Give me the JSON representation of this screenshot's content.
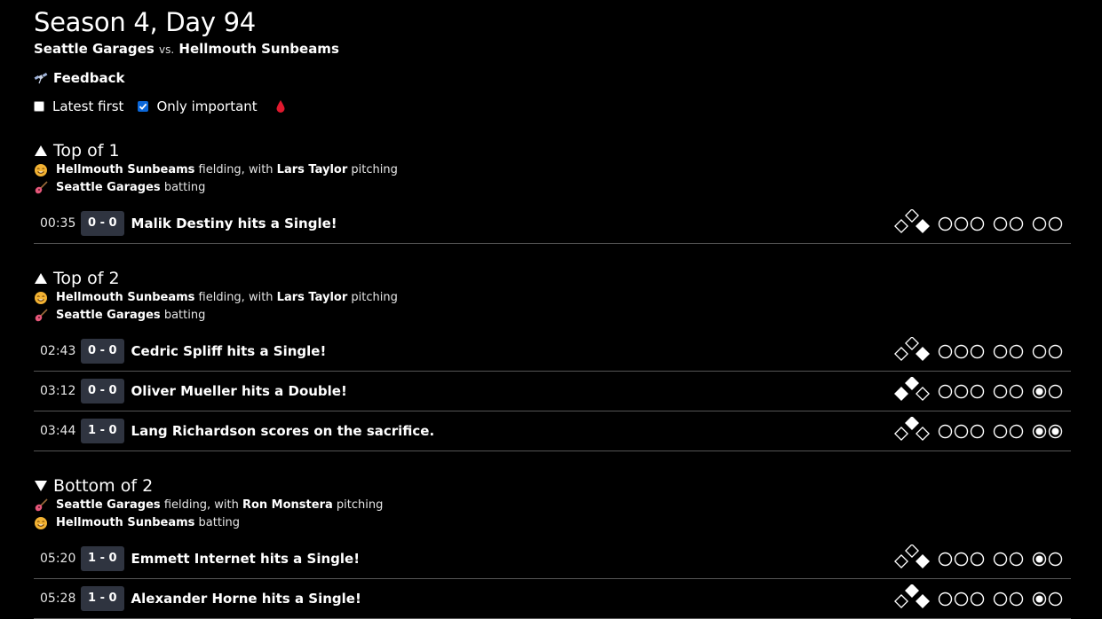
{
  "page": {
    "title": "Season 4, Day 94",
    "away_team": "Seattle Garages",
    "vs": "vs.",
    "home_team": "Hellmouth Sunbeams",
    "feedback_label": "Feedback",
    "options": [
      {
        "label": "Latest first",
        "checked": false
      },
      {
        "label": "Only important",
        "checked": true
      }
    ]
  },
  "halves": [
    {
      "heading": "Top of 1",
      "direction": "up",
      "fielding_team": "Hellmouth Sunbeams",
      "fielding_text": "fielding, with",
      "pitcher": "Lars Taylor",
      "pitching_text": "pitching",
      "batting_team": "Seattle Garages",
      "batting_text": "batting",
      "fielding_icon": "sun-face-icon",
      "batting_icon": "guitar-icon",
      "events": [
        {
          "time": "00:35",
          "score": "0 - 0",
          "text": "Malik Destiny hits a Single!",
          "bases": [
            true,
            false,
            false
          ],
          "balls": 0,
          "strikes": 0,
          "outs": 0
        }
      ]
    },
    {
      "heading": "Top of 2",
      "direction": "up",
      "fielding_team": "Hellmouth Sunbeams",
      "fielding_text": "fielding, with",
      "pitcher": "Lars Taylor",
      "pitching_text": "pitching",
      "batting_team": "Seattle Garages",
      "batting_text": "batting",
      "fielding_icon": "sun-face-icon",
      "batting_icon": "guitar-icon",
      "events": [
        {
          "time": "02:43",
          "score": "0 - 0",
          "text": "Cedric Spliff hits a Single!",
          "bases": [
            true,
            false,
            false
          ],
          "balls": 0,
          "strikes": 0,
          "outs": 0
        },
        {
          "time": "03:12",
          "score": "0 - 0",
          "text": "Oliver Mueller hits a Double!",
          "bases": [
            false,
            true,
            true
          ],
          "balls": 0,
          "strikes": 0,
          "outs": 1
        },
        {
          "time": "03:44",
          "score": "1 - 0",
          "text": "Lang Richardson scores on the sacrifice.",
          "bases": [
            false,
            true,
            false
          ],
          "balls": 0,
          "strikes": 0,
          "outs": 2
        }
      ]
    },
    {
      "heading": "Bottom of 2",
      "direction": "down",
      "fielding_team": "Seattle Garages",
      "fielding_text": "fielding, with",
      "pitcher": "Ron Monstera",
      "pitching_text": "pitching",
      "batting_team": "Hellmouth Sunbeams",
      "batting_text": "batting",
      "fielding_icon": "guitar-icon",
      "batting_icon": "sun-face-icon",
      "events": [
        {
          "time": "05:20",
          "score": "1 - 0",
          "text": "Emmett Internet hits a Single!",
          "bases": [
            true,
            false,
            false
          ],
          "balls": 0,
          "strikes": 0,
          "outs": 1
        },
        {
          "time": "05:28",
          "score": "1 - 0",
          "text": "Alexander Horne hits a Single!",
          "bases": [
            true,
            true,
            false
          ],
          "balls": 0,
          "strikes": 0,
          "outs": 1
        }
      ]
    }
  ],
  "colors": {
    "background": "#000000",
    "score_badge": "#2f3440",
    "divider": "#555555",
    "checkbox_checked": "#0b67d9",
    "blood_drop": "#e0192e"
  }
}
